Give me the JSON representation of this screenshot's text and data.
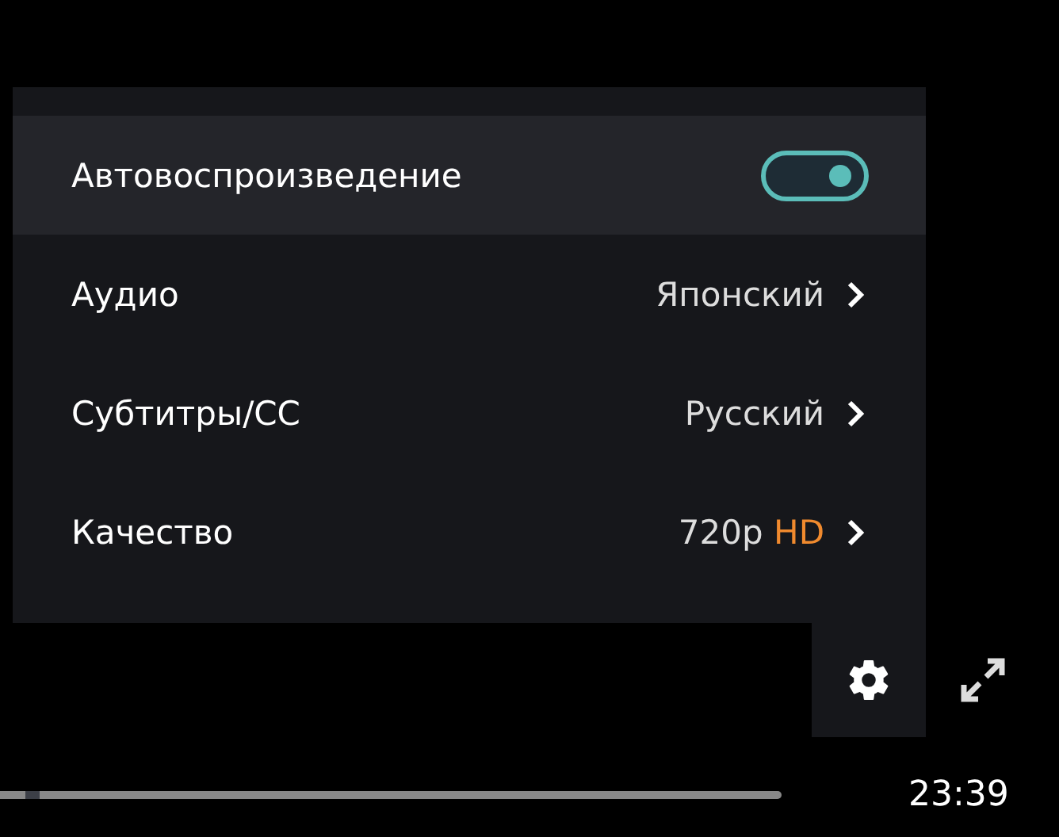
{
  "settings_menu": {
    "items": [
      {
        "kind": "toggle",
        "label": "Автовоспроизведение",
        "on": true,
        "selected": true
      },
      {
        "kind": "submenu",
        "label": "Аудио",
        "value": "Японский",
        "selected": false
      },
      {
        "kind": "submenu",
        "label": "Субтитры/CC",
        "value": "Русский",
        "selected": false
      },
      {
        "kind": "submenu",
        "label": "Качество",
        "value": "720p",
        "badge": "HD",
        "selected": false
      }
    ]
  },
  "controls": {
    "settings_open": true,
    "progress": {
      "level": 0.04
    },
    "time": "23:39"
  }
}
